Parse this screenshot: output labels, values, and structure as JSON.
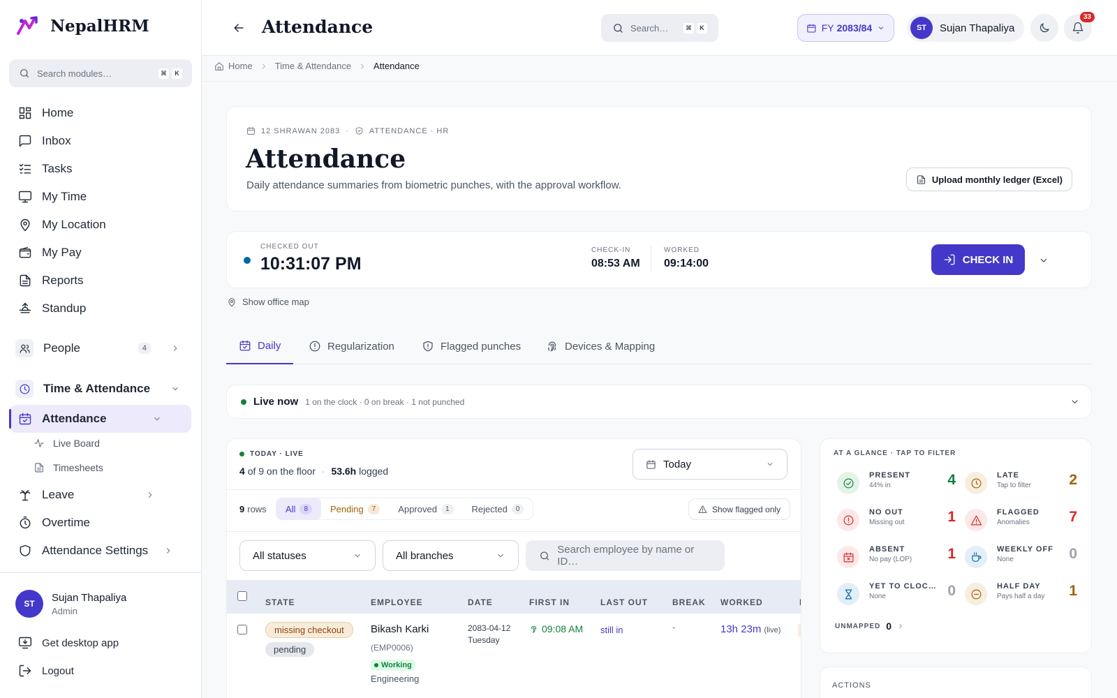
{
  "brand": {
    "name": "NepalHRM"
  },
  "sidebar": {
    "search_placeholder": "Search modules…",
    "shortcut": [
      "⌘",
      "K"
    ],
    "items": [
      {
        "label": "Home"
      },
      {
        "label": "Inbox"
      },
      {
        "label": "Tasks"
      },
      {
        "label": "My Time"
      },
      {
        "label": "My Location"
      },
      {
        "label": "My Pay"
      },
      {
        "label": "Reports"
      },
      {
        "label": "Standup"
      }
    ],
    "people": {
      "label": "People",
      "count": "4"
    },
    "time_attendance": {
      "label": "Time & Attendance"
    },
    "attendance": {
      "label": "Attendance"
    },
    "sub_items": [
      {
        "label": "Live Board"
      },
      {
        "label": "Timesheets"
      }
    ],
    "leave": {
      "label": "Leave"
    },
    "overtime": {
      "label": "Overtime"
    },
    "attendance_settings": {
      "label": "Attendance Settings"
    },
    "user": {
      "initials": "ST",
      "name": "Sujan Thapaliya",
      "role": "Admin"
    },
    "desktop_app": "Get desktop app",
    "logout": "Logout"
  },
  "topbar": {
    "title": "Attendance",
    "search_placeholder": "Search…",
    "shortcut": [
      "⌘",
      "K"
    ],
    "fy_prefix": "FY",
    "fy_value": "2083/84",
    "user_initials": "ST",
    "user_name": "Sujan Thapaliya",
    "notifications": "33"
  },
  "breadcrumb": [
    "Home",
    "Time & Attendance",
    "Attendance"
  ],
  "header": {
    "date": "12 SHRAWAN 2083",
    "context": "ATTENDANCE · HR",
    "title": "Attendance",
    "description": "Daily attendance summaries from biometric punches, with the approval workflow.",
    "upload_label": "Upload monthly ledger (Excel)"
  },
  "clock": {
    "status": "CHECKED OUT",
    "time": "10:31:07 PM",
    "checkin_label": "CHECK-IN",
    "checkin_value": "08:53 AM",
    "worked_label": "WORKED",
    "worked_value": "09:14:00",
    "button": "CHECK IN",
    "show_map": "Show office map"
  },
  "tabs": [
    {
      "label": "Daily"
    },
    {
      "label": "Regularization"
    },
    {
      "label": "Flagged punches"
    },
    {
      "label": "Devices & Mapping"
    }
  ],
  "live": {
    "label": "Live now",
    "summary": "1 on the clock · 0 on break · 1 not punched"
  },
  "today": {
    "label": "TODAY · LIVE",
    "floor_count": "4",
    "floor_text": "of 9 on the floor",
    "logged_value": "53.6h",
    "logged_text": "logged",
    "range_value": "Today"
  },
  "filters": {
    "rows_count": "9",
    "rows_label": "rows",
    "pills": [
      {
        "label": "All",
        "count": "8"
      },
      {
        "label": "Pending",
        "count": "7"
      },
      {
        "label": "Approved",
        "count": "1"
      },
      {
        "label": "Rejected",
        "count": "0"
      }
    ],
    "flagged_only": "Show flagged only",
    "status_select": "All statuses",
    "branch_select": "All branches",
    "employee_search_placeholder": "Search employee by name or ID…"
  },
  "table": {
    "headers": [
      "STATE",
      "EMPLOYEE",
      "DATE",
      "FIRST IN",
      "LAST OUT",
      "BREAK",
      "WORKED",
      "F"
    ],
    "rows": [
      {
        "state_tags": [
          "missing checkout",
          "pending"
        ],
        "employee_name": "Bikash Karki",
        "employee_id": "(EMP0006)",
        "status": "Working",
        "department": "Engineering",
        "date": "2083-04-12",
        "weekday": "Tuesday",
        "first_in": "09:08 AM",
        "last_out": "still in",
        "break": "-",
        "worked": "13h 23m",
        "worked_note": "(live)"
      }
    ]
  },
  "glance": {
    "title": "AT A GLANCE · TAP TO FILTER",
    "items": [
      {
        "label": "PRESENT",
        "sub": "44% in",
        "value": "4",
        "color": "#15803d"
      },
      {
        "label": "LATE",
        "sub": "Tap to filter",
        "value": "2",
        "color": "#a16207"
      },
      {
        "label": "NO OUT",
        "sub": "Missing out",
        "value": "1",
        "color": "#dc2626"
      },
      {
        "label": "FLAGGED",
        "sub": "Anomalies",
        "value": "7",
        "color": "#dc2626"
      },
      {
        "label": "ABSENT",
        "sub": "No pay (LOP)",
        "value": "1",
        "color": "#dc2626"
      },
      {
        "label": "WEEKLY OFF",
        "sub": "None",
        "value": "0",
        "color": "#9ca3af"
      },
      {
        "label": "YET TO CLOC…",
        "sub": "None",
        "value": "0",
        "color": "#9ca3af"
      },
      {
        "label": "HALF DAY",
        "sub": "Pays half a day",
        "value": "1",
        "color": "#a16207"
      }
    ],
    "unmapped_label": "UNMAPPED",
    "unmapped_value": "0"
  },
  "actions": {
    "title": "ACTIONS"
  },
  "colors": {
    "accent": "#4338ca",
    "success": "#15803d",
    "danger": "#dc2626",
    "warning": "#a16207"
  }
}
